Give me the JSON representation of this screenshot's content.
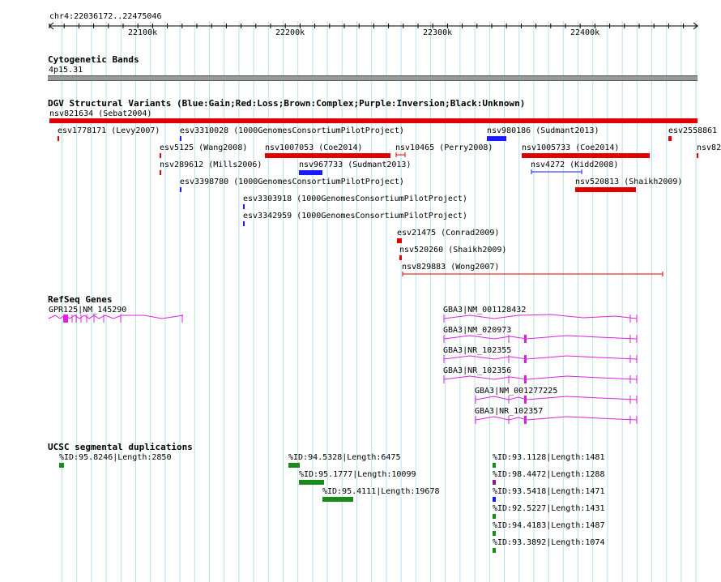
{
  "region_label": "chr4:22036172..22475046",
  "ruler_ticks": [
    "22100k",
    "22200k",
    "22300k",
    "22400k"
  ],
  "sections": {
    "cyto": "Cytogenetic Bands",
    "dgv": "DGV Structural Variants (Blue:Gain;Red:Loss;Brown:Complex;Purple:Inversion;Black:Unknown)",
    "refseq": "RefSeq Genes",
    "segdup": "UCSC segmental duplications"
  },
  "cyto_band": "4p15.31",
  "colors": {
    "loss": "#e00000",
    "gain": "#1a1aff",
    "gene": "#e020e0",
    "segdup_green": "#1a8a1a",
    "segdup_purple": "#8a1a8a",
    "segdup_blue": "#1a1aff",
    "band": "#999999",
    "grid": "#aaddee"
  },
  "variants": [
    {
      "label": "nsv821634 (Sebat2004)",
      "type": "loss"
    },
    {
      "label": "esv1778171 (Levy2007)",
      "type": "loss"
    },
    {
      "label": "esv3310028 (1000GenomesConsortiumPilotProject)",
      "type": "gain"
    },
    {
      "label": "nsv980186 (Sudmant2013)",
      "type": "gain"
    },
    {
      "label": "esv2558861",
      "type": "loss"
    },
    {
      "label": "esv5125 (Wang2008)",
      "type": "loss"
    },
    {
      "label": "nsv1007053 (Coe2014)",
      "type": "loss"
    },
    {
      "label": "nsv10465 (Perry2008)",
      "type": "loss"
    },
    {
      "label": "nsv1005733 (Coe2014)",
      "type": "loss"
    },
    {
      "label": "nsv82",
      "type": "loss"
    },
    {
      "label": "nsv289612 (Mills2006)",
      "type": "loss"
    },
    {
      "label": "nsv967733 (Sudmant2013)",
      "type": "gain"
    },
    {
      "label": "nsv4272 (Kidd2008)",
      "type": "gain"
    },
    {
      "label": "esv3398780 (1000GenomesConsortiumPilotProject)",
      "type": "gain"
    },
    {
      "label": "nsv520813 (Shaikh2009)",
      "type": "loss"
    },
    {
      "label": "esv3303918 (1000GenomesConsortiumPilotProject)",
      "type": "gain"
    },
    {
      "label": "esv3342959 (1000GenomesConsortiumPilotProject)",
      "type": "gain"
    },
    {
      "label": "esv21475 (Conrad2009)",
      "type": "loss"
    },
    {
      "label": "nsv520260 (Shaikh2009)",
      "type": "loss"
    },
    {
      "label": "nsv829883 (Wong2007)",
      "type": "loss"
    }
  ],
  "genes": [
    "GPR125|NM_145290",
    "GBA3|NM_001128432",
    "GBA3|NM_020973",
    "GBA3|NR_102355",
    "GBA3|NR_102356",
    "GBA3|NM_001277225",
    "GBA3|NR_102357"
  ],
  "segdups": [
    {
      "label": "%ID:95.8246|Length:2850",
      "color": "green"
    },
    {
      "label": "%ID:94.5328|Length:6475",
      "color": "green"
    },
    {
      "label": "%ID:95.1777|Length:10099",
      "color": "green"
    },
    {
      "label": "%ID:95.4111|Length:19678",
      "color": "green"
    },
    {
      "label": "%ID:93.1128|Length:1481",
      "color": "green"
    },
    {
      "label": "%ID:98.4472|Length:1288",
      "color": "purple"
    },
    {
      "label": "%ID:93.5418|Length:1471",
      "color": "blue"
    },
    {
      "label": "%ID:92.5227|Length:1431",
      "color": "green"
    },
    {
      "label": "%ID:94.4183|Length:1487",
      "color": "green"
    },
    {
      "label": "%ID:93.3892|Length:1074",
      "color": "green"
    }
  ]
}
